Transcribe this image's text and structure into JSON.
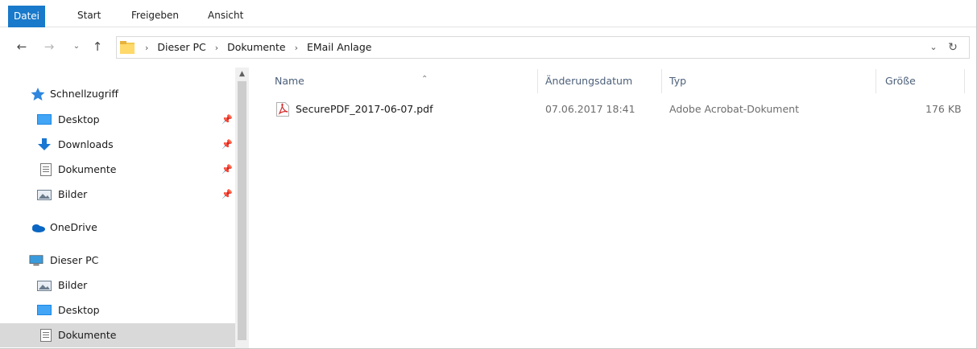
{
  "ribbon": {
    "tabs": [
      "Datei",
      "Start",
      "Freigeben",
      "Ansicht"
    ]
  },
  "nav": {
    "back_icon": "back-arrow-icon",
    "forward_icon": "forward-arrow-icon",
    "recent_icon": "chevron-down-icon",
    "up_icon": "up-arrow-icon"
  },
  "address": {
    "crumbs": [
      "Dieser PC",
      "Dokumente",
      "EMail Anlage"
    ]
  },
  "sidebar": {
    "items": [
      {
        "label": "Schnellzugriff",
        "icon": "star-icon"
      },
      {
        "label": "Desktop",
        "icon": "desktop-icon"
      },
      {
        "label": "Downloads",
        "icon": "download-icon"
      },
      {
        "label": "Dokumente",
        "icon": "document-icon"
      },
      {
        "label": "Bilder",
        "icon": "pictures-icon"
      },
      {
        "label": "OneDrive",
        "icon": "cloud-icon"
      },
      {
        "label": "Dieser PC",
        "icon": "computer-icon"
      },
      {
        "label": "Bilder",
        "icon": "pictures-icon"
      },
      {
        "label": "Desktop",
        "icon": "desktop-icon"
      },
      {
        "label": "Dokumente",
        "icon": "document-icon"
      }
    ]
  },
  "columns": {
    "name": "Name",
    "date": "Änderungsdatum",
    "type": "Typ",
    "size": "Größe"
  },
  "files": [
    {
      "name": "SecurePDF_2017-06-07.pdf",
      "date": "07.06.2017 18:41",
      "type": "Adobe Acrobat-Dokument",
      "size": "176 KB",
      "icon": "pdf-icon"
    }
  ],
  "colors": {
    "accent": "#1979ca",
    "selection": "#cce8ff",
    "header_text": "#4c607a"
  }
}
